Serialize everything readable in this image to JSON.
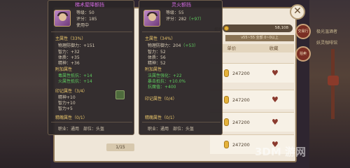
{
  "background": {
    "top_right_text": "极光温酒者",
    "right_text": "妖灵咖啡馆",
    "left_text": "..."
  },
  "market": {
    "owned_label": "拥有",
    "money_value": "58,108",
    "filter_tab": "v55~55 全部 0~0以上",
    "columns": [
      "单价",
      "收藏"
    ],
    "rows": [
      {
        "price": "247200"
      },
      {
        "price": "247200"
      },
      {
        "price": "247200"
      },
      {
        "price": "247200"
      }
    ],
    "page": "1/15"
  },
  "side_tabs": [
    "交易行",
    "拍卖"
  ],
  "card_left": {
    "title": "梯术屋降额挡",
    "level": "等级：50",
    "score": "评分：185",
    "status": "使用中",
    "main_title": "主属性（33%）",
    "main_stats": [
      {
        "text": "物理防御力：+151"
      },
      {
        "text": "智力：+32"
      },
      {
        "text": "体质：+35"
      },
      {
        "text": "精神：+36"
      }
    ],
    "extra_title": "附加属性",
    "extra_stats": [
      {
        "text": "毒属性抵抗：+14"
      },
      {
        "text": "火属性抵抗：+14"
      }
    ],
    "mark_title": "印记属性（3/4）",
    "mark_stats": [
      {
        "text": "精神+10"
      },
      {
        "text": "智力+10"
      },
      {
        "text": "智力+5"
      }
    ],
    "refine_title": "精魄属性（0/1）",
    "footer": "职业：通用　部位：头盔"
  },
  "card_right": {
    "title": "灵火额挡",
    "level": "等级：55",
    "score_prefix": "评分：282",
    "score_delta": "（+97）",
    "main_title": "主属性（34%）",
    "main_stats": [
      {
        "text": "物理防御力：204",
        "bonus": "（+53）"
      },
      {
        "text": "智力：52",
        "bonus": ""
      },
      {
        "text": "体质：56",
        "bonus": ""
      },
      {
        "text": "精神：52",
        "bonus": ""
      }
    ],
    "extra_title": "附加属性",
    "extra_stats": [
      {
        "text": "法属性强化：+22"
      },
      {
        "text": "暴击抵抗：+10.0%"
      },
      {
        "text": "抗魔值：+400"
      }
    ],
    "mark_title": "印记属性（0/4）",
    "refine_title": "精魄属性（0/1）",
    "footer": "职业：通用　部位：头盔"
  },
  "watermark": "3DM 游网",
  "colors": {
    "title_purple": "#d36ae0",
    "section_gold": "#e8c46a",
    "bonus_green": "#5ecb5e",
    "card_bg": "#2c2628",
    "heart": "#8b3a2e"
  }
}
